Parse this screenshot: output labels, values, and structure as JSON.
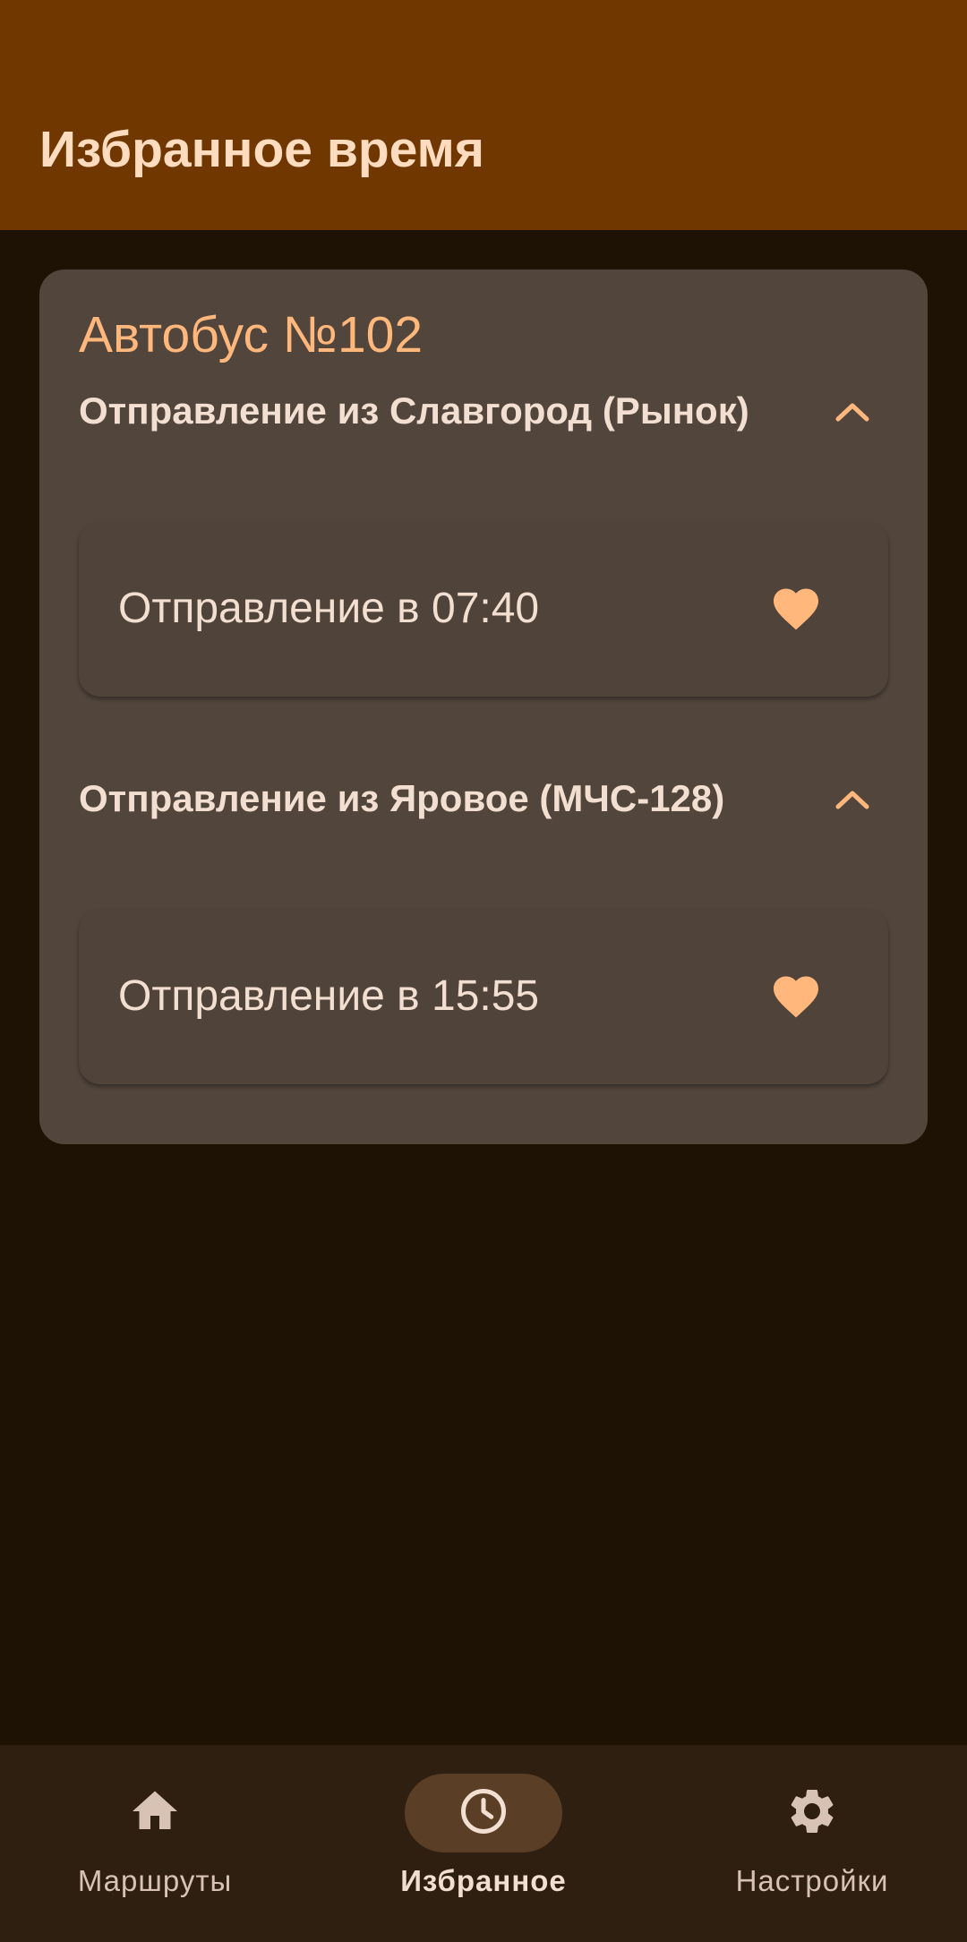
{
  "app_bar": {
    "title": "Избранное время"
  },
  "route": {
    "title": "Автобус №102",
    "sections": [
      {
        "header": "Отправление из Славгород (Рынок)",
        "expanded": true,
        "times": [
          {
            "label": "Отправление в 07:40",
            "favorite": true
          }
        ]
      },
      {
        "header": "Отправление из Яровое (МЧС-128)",
        "expanded": true,
        "times": [
          {
            "label": "Отправление в 15:55",
            "favorite": true
          }
        ]
      }
    ]
  },
  "bottom_nav": {
    "items": [
      {
        "label": "Маршруты",
        "icon": "home-icon",
        "active": false
      },
      {
        "label": "Избранное",
        "icon": "clock-icon",
        "active": true
      },
      {
        "label": "Настройки",
        "icon": "gear-icon",
        "active": false
      }
    ]
  },
  "colors": {
    "app_bar": "#703800",
    "background": "#1E1204",
    "card": "#51453C",
    "accent": "#FFB77C",
    "title_text": "#FFDCC0",
    "nav_bar": "#2F1F11",
    "nav_active_pill": "#5A3F26"
  }
}
